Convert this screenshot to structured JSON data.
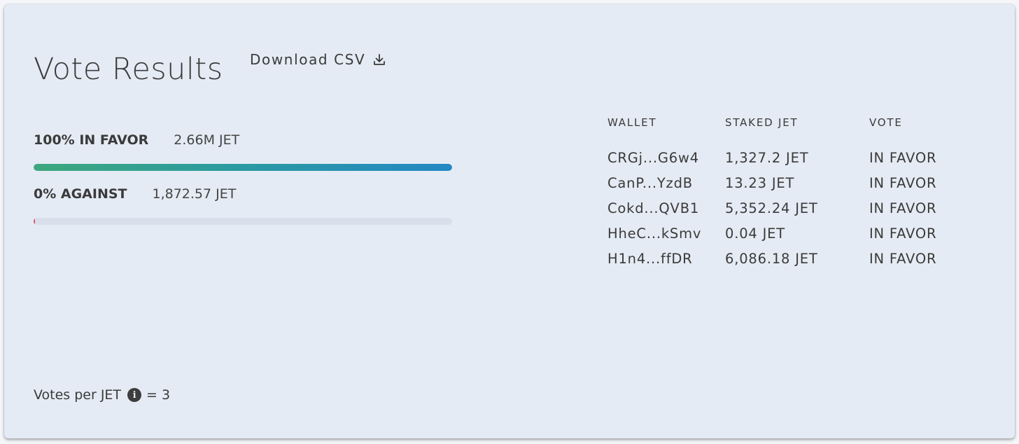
{
  "header": {
    "title": "Vote Results",
    "download_label": "Download CSV",
    "download_icon": "download-icon"
  },
  "results": {
    "favor": {
      "label": "100% IN FAVOR",
      "amount": "2.66M JET",
      "percent": 100,
      "color": "#2a9aa2"
    },
    "against": {
      "label": "0% AGAINST",
      "amount": "1,872.57 JET",
      "percent": 0.3,
      "color": "#e8485f"
    }
  },
  "table": {
    "headers": [
      "WALLET",
      "STAKED JET",
      "VOTE"
    ],
    "rows": [
      [
        "CRGj...G6w4",
        "1,327.2 JET",
        "IN FAVOR"
      ],
      [
        "CanP...YzdB",
        "13.23 JET",
        "IN FAVOR"
      ],
      [
        "Cokd...QVB1",
        "5,352.24 JET",
        "IN FAVOR"
      ],
      [
        "HheC...kSmv",
        "0.04 JET",
        "IN FAVOR"
      ],
      [
        "H1n4...ffDR",
        "6,086.18 JET",
        "IN FAVOR"
      ]
    ]
  },
  "footer": {
    "votes_label": "Votes per JET",
    "info_icon": "info-icon",
    "info_glyph": "i",
    "votes_value": "= 3"
  }
}
